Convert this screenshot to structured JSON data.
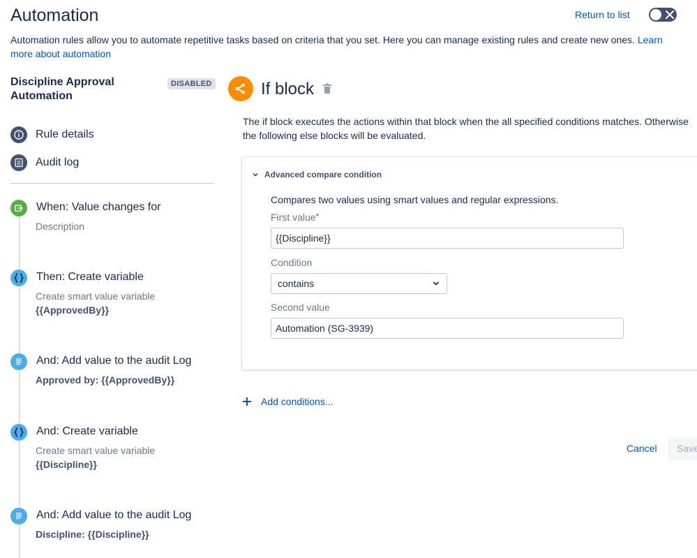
{
  "header": {
    "title": "Automation",
    "return_link": "Return to list",
    "toggle_state": "off"
  },
  "intro": {
    "text": "Automation rules allow you to automate repetitive tasks based on criteria that you set. Here you can manage existing rules and create new ones.",
    "link": "Learn more about automation"
  },
  "sidebar": {
    "rule_name": "Discipline Approval Automation",
    "status": "DISABLED",
    "nav": [
      {
        "label": "Rule details",
        "icon": "info-icon"
      },
      {
        "label": "Audit log",
        "icon": "list-icon"
      }
    ],
    "steps": [
      {
        "title": "When: Value changes for",
        "subtitle": "Description",
        "detail": "",
        "icon": "trigger-icon",
        "color": "#5aac44"
      },
      {
        "title": "Then: Create variable",
        "subtitle": "Create smart value variable",
        "detail": "{{ApprovedBy}}",
        "icon": "braces-icon",
        "color": "#4bade8"
      },
      {
        "title": "And: Add value to the audit Log",
        "subtitle": "",
        "detail": "Approved by: {{ApprovedBy}}",
        "icon": "document-icon",
        "color": "#4bade8"
      },
      {
        "title": "And: Create variable",
        "subtitle": "Create smart value variable",
        "detail": "{{Discipline}}",
        "icon": "braces-icon",
        "color": "#4bade8"
      },
      {
        "title": "And: Add value to the audit Log",
        "subtitle": "",
        "detail": "Discipline: {{Discipline}}",
        "icon": "document-icon",
        "color": "#4bade8"
      }
    ]
  },
  "main": {
    "block_title": "If block",
    "block_color": "#ff8b00",
    "description_line1": "The if block executes the actions within that block when the all specified conditions matches. Otherwise",
    "description_line2": "the following else blocks will be evaluated.",
    "condition": {
      "header": "Advanced compare condition",
      "description": "Compares two values using smart values and regular expressions.",
      "first_value_label": "First value",
      "required_mark": "*",
      "first_value": "{{Discipline}}",
      "condition_label": "Condition",
      "condition_value": "contains",
      "second_value_label": "Second value",
      "second_value": "Automation (SG-3939)"
    },
    "add_conditions": "Add conditions...",
    "cancel": "Cancel",
    "save": "Save"
  }
}
